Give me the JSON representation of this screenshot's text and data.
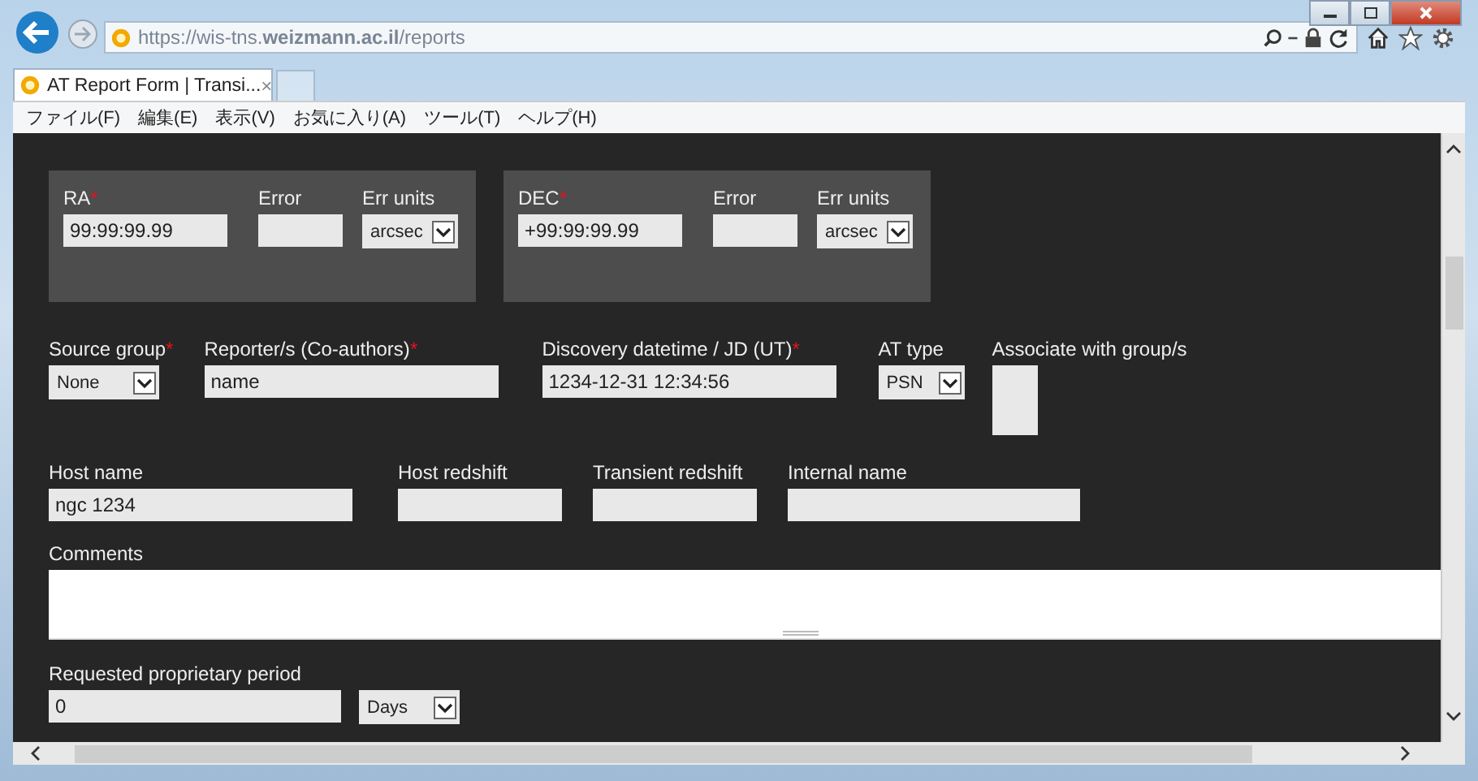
{
  "browser": {
    "url": "https://wis-tns.**weizmann.ac.il**/reports",
    "tab": {
      "title": "AT Report Form | Transi...",
      "close": "×",
      "selected": true
    },
    "menu": [
      "ファイル(F)",
      "編集(E)",
      "表示(V)",
      "お気に入り(A)",
      "ツール(T)",
      "ヘルプ(H)"
    ]
  },
  "coordinates": [
    {
      "label": "RA",
      "required_mark": "*",
      "value": "99:99:99.99",
      "error_label": "Error",
      "units_label": "Err units",
      "units": "arcsec"
    },
    {
      "label": "DEC",
      "required_mark": "*",
      "value": "+99:99:99.99",
      "error_label": "Error",
      "units_label": "Err units",
      "units": "arcsec"
    }
  ],
  "details": [
    {
      "label": "Source group",
      "required_mark": "*",
      "kind": "select",
      "value": "None"
    },
    {
      "label": "Reporter/s (Co-authors)",
      "required_mark": "*",
      "kind": "text",
      "value": "name"
    },
    {
      "label": "Discovery datetime / JD (UT)",
      "required_mark": "*",
      "kind": "text",
      "value": "1234-12-31 12:34:56"
    },
    {
      "label": "AT type",
      "kind": "select",
      "value": "PSN"
    },
    {
      "label": "Associate with group/s",
      "kind": "list"
    }
  ],
  "host": [
    {
      "label": "Host name",
      "value": "ngc 1234"
    },
    {
      "label": "Host redshift"
    },
    {
      "label": "Transient redshift"
    },
    {
      "label": "Internal name"
    }
  ],
  "comments": {
    "label": "Comments"
  },
  "proprietary": {
    "label": "Requested proprietary period",
    "value": "0",
    "unit": "Days"
  }
}
